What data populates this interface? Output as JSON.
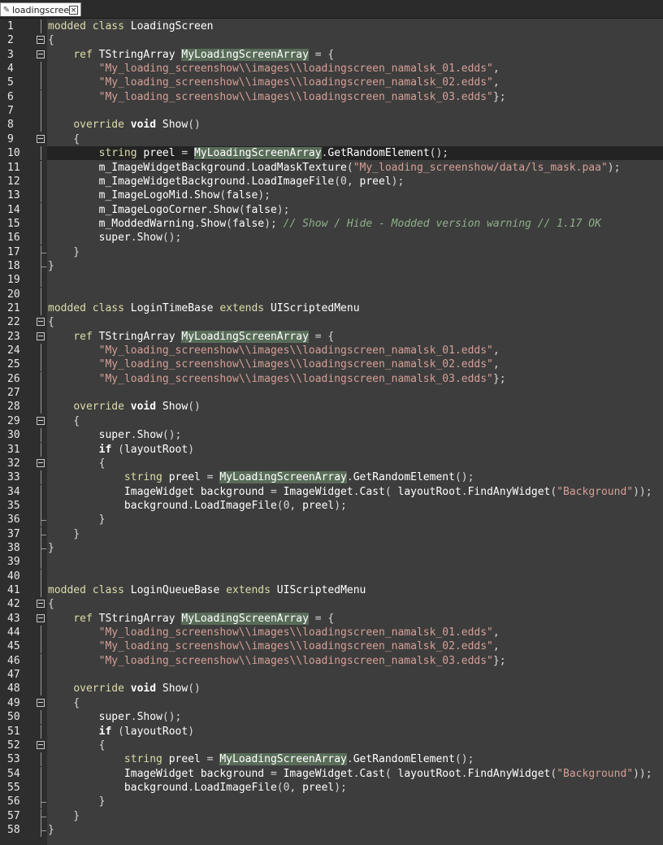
{
  "tab": {
    "filename": "loadingscreen.c",
    "pencil_icon": "pencil-icon",
    "close_icon": "close-icon"
  },
  "colors": {
    "keyword": "#dcdcaa",
    "string": "#d69f96",
    "comment": "#8fb08a",
    "highlight": "#586c58"
  },
  "lines": [
    {
      "n": "1",
      "t": "modded class LoadingScreen"
    },
    {
      "n": "2",
      "t": "{"
    },
    {
      "n": "3",
      "t": "    ref TStringArray MyLoadingScreenArray = {"
    },
    {
      "n": "4",
      "t": "        \"My_loading_screenshow\\\\images\\\\loadingscreen_namalsk_01.edds\","
    },
    {
      "n": "5",
      "t": "        \"My_loading_screenshow\\\\images\\\\loadingscreen_namalsk_02.edds\","
    },
    {
      "n": "6",
      "t": "        \"My_loading_screenshow\\\\images\\\\loadingscreen_namalsk_03.edds\"};"
    },
    {
      "n": "7",
      "t": ""
    },
    {
      "n": "8",
      "t": "    override void Show()"
    },
    {
      "n": "9",
      "t": "    {"
    },
    {
      "n": "10",
      "t": "        string preel = MyLoadingScreenArray.GetRandomElement();"
    },
    {
      "n": "11",
      "t": "        m_ImageWidgetBackground.LoadMaskTexture(\"My_loading_screenshow/data/ls_mask.paa\");"
    },
    {
      "n": "12",
      "t": "        m_ImageWidgetBackground.LoadImageFile(0, preel);"
    },
    {
      "n": "13",
      "t": "        m_ImageLogoMid.Show(false);"
    },
    {
      "n": "14",
      "t": "        m_ImageLogoCorner.Show(false);"
    },
    {
      "n": "15",
      "t": "        m_ModdedWarning.Show(false); // Show / Hide - Modded version warning // 1.17 OK"
    },
    {
      "n": "16",
      "t": "        super.Show();"
    },
    {
      "n": "17",
      "t": "    }"
    },
    {
      "n": "18",
      "t": "}"
    },
    {
      "n": "19",
      "t": ""
    },
    {
      "n": "20",
      "t": ""
    },
    {
      "n": "21",
      "t": "modded class LoginTimeBase extends UIScriptedMenu"
    },
    {
      "n": "22",
      "t": "{"
    },
    {
      "n": "23",
      "t": "    ref TStringArray MyLoadingScreenArray = {"
    },
    {
      "n": "24",
      "t": "        \"My_loading_screenshow\\\\images\\\\loadingscreen_namalsk_01.edds\","
    },
    {
      "n": "25",
      "t": "        \"My_loading_screenshow\\\\images\\\\loadingscreen_namalsk_02.edds\","
    },
    {
      "n": "26",
      "t": "        \"My_loading_screenshow\\\\images\\\\loadingscreen_namalsk_03.edds\"};"
    },
    {
      "n": "27",
      "t": ""
    },
    {
      "n": "28",
      "t": "    override void Show()"
    },
    {
      "n": "29",
      "t": "    {"
    },
    {
      "n": "30",
      "t": "        super.Show();"
    },
    {
      "n": "31",
      "t": "        if (layoutRoot)"
    },
    {
      "n": "32",
      "t": "        {"
    },
    {
      "n": "33",
      "t": "            string preel = MyLoadingScreenArray.GetRandomElement();"
    },
    {
      "n": "34",
      "t": "            ImageWidget background = ImageWidget.Cast( layoutRoot.FindAnyWidget(\"Background\"));"
    },
    {
      "n": "35",
      "t": "            background.LoadImageFile(0, preel);"
    },
    {
      "n": "36",
      "t": "        }"
    },
    {
      "n": "37",
      "t": "    }"
    },
    {
      "n": "38",
      "t": "}"
    },
    {
      "n": "39",
      "t": ""
    },
    {
      "n": "40",
      "t": ""
    },
    {
      "n": "41",
      "t": "modded class LoginQueueBase extends UIScriptedMenu"
    },
    {
      "n": "42",
      "t": "{"
    },
    {
      "n": "43",
      "t": "    ref TStringArray MyLoadingScreenArray = {"
    },
    {
      "n": "44",
      "t": "        \"My_loading_screenshow\\\\images\\\\loadingscreen_namalsk_01.edds\","
    },
    {
      "n": "45",
      "t": "        \"My_loading_screenshow\\\\images\\\\loadingscreen_namalsk_02.edds\","
    },
    {
      "n": "46",
      "t": "        \"My_loading_screenshow\\\\images\\\\loadingscreen_namalsk_03.edds\"};"
    },
    {
      "n": "47",
      "t": ""
    },
    {
      "n": "48",
      "t": "    override void Show()"
    },
    {
      "n": "49",
      "t": "    {"
    },
    {
      "n": "50",
      "t": "        super.Show();"
    },
    {
      "n": "51",
      "t": "        if (layoutRoot)"
    },
    {
      "n": "52",
      "t": "        {"
    },
    {
      "n": "53",
      "t": "            string preel = MyLoadingScreenArray.GetRandomElement();"
    },
    {
      "n": "54",
      "t": "            ImageWidget background = ImageWidget.Cast( layoutRoot.FindAnyWidget(\"Background\"));"
    },
    {
      "n": "55",
      "t": "            background.LoadImageFile(0, preel);"
    },
    {
      "n": "56",
      "t": "        }"
    },
    {
      "n": "57",
      "t": "    }"
    },
    {
      "n": "58",
      "t": "}"
    }
  ]
}
